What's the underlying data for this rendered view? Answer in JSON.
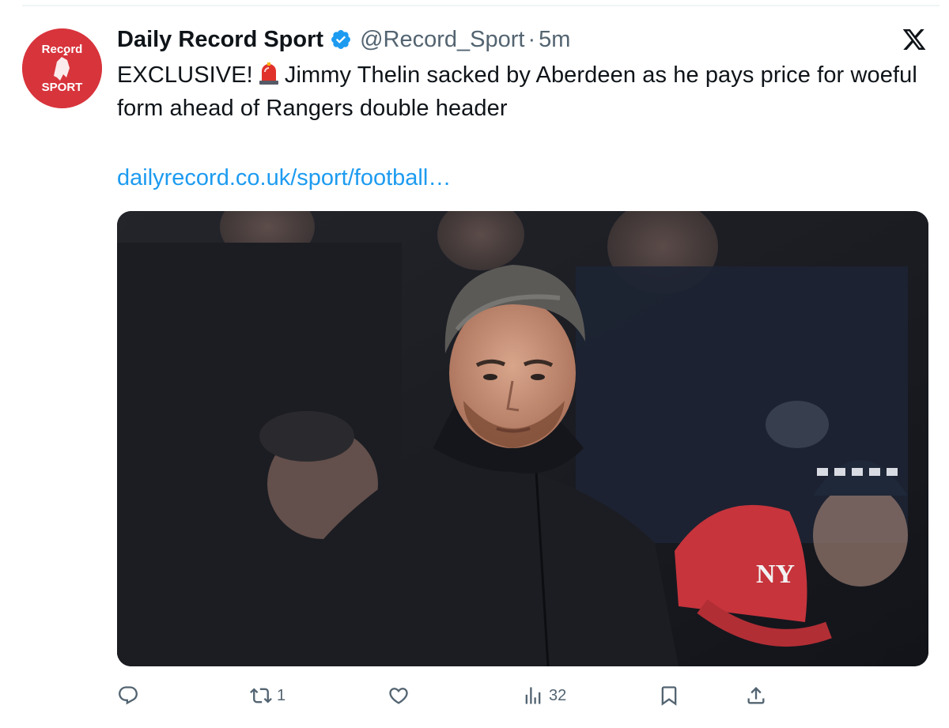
{
  "author": {
    "display_name": "Daily Record Sport",
    "handle": "@Record_Sport",
    "separator": "·",
    "timestamp": "5m",
    "avatar_lines": [
      "Record",
      "SPORT"
    ]
  },
  "tweet": {
    "text_before": "EXCLUSIVE!",
    "emoji": "siren-emoji",
    "text_after": "Jimmy Thelin sacked by Aberdeen as he pays price for woeful form ahead of Rangers double header",
    "link": "dailyrecord.co.uk/sport/football…"
  },
  "actions": {
    "reply_count": "",
    "retweet_count": "1",
    "like_count": "",
    "views_count": "32"
  },
  "icons": {
    "verified": "verified-badge-icon",
    "platform": "x-logo-icon",
    "reply": "reply-icon",
    "retweet": "retweet-icon",
    "like": "like-icon",
    "views": "views-icon",
    "bookmark": "bookmark-icon",
    "share": "share-icon"
  },
  "colors": {
    "link": "#1d9bf0",
    "verified": "#1d9bf0",
    "muted": "#536471",
    "avatar_bg": "#d8343c",
    "text": "#0f1419"
  }
}
